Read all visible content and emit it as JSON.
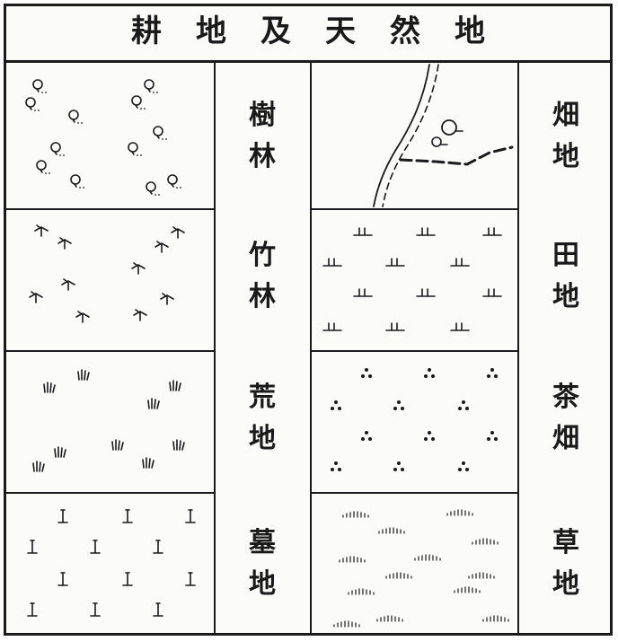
{
  "title": "耕地及天然地",
  "left_column": [
    {
      "label": "樹林",
      "symbol": "tree-circle-icon"
    },
    {
      "label": "竹林",
      "symbol": "bamboo-icon"
    },
    {
      "label": "荒地",
      "symbol": "grass-tuft-icon"
    },
    {
      "label": "墓地",
      "symbol": "tombstone-icon"
    }
  ],
  "right_column": [
    {
      "label": "畑地",
      "symbol": "dashed-boundary-icon"
    },
    {
      "label": "田地",
      "symbol": "rice-paddy-icon"
    },
    {
      "label": "茶畑",
      "symbol": "three-dot-icon"
    },
    {
      "label": "草地",
      "symbol": "grass-arc-icon"
    }
  ]
}
